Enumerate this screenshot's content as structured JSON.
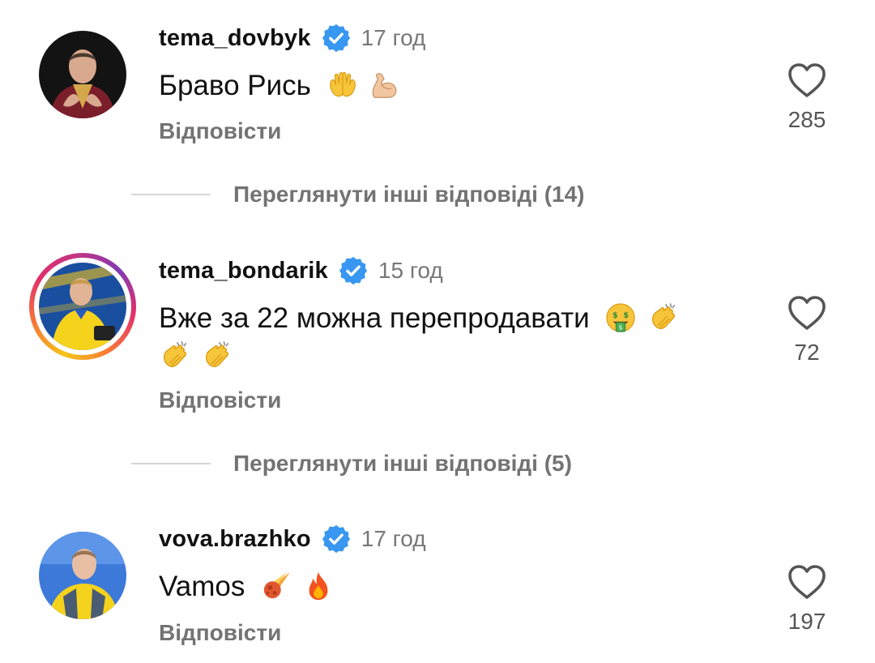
{
  "comments": [
    {
      "username": "tema_dovbyk",
      "time": "17 год",
      "text": "Браво Рись",
      "emojis": [
        "raising-hands-emoji",
        "flexed-biceps-emoji"
      ],
      "reply_label": "Відповісти",
      "likes": "285",
      "verified": true
    },
    {
      "username": "tema_bondarik",
      "time": "15 год",
      "text": "Вже за 22 можна перепродавати",
      "emojis": [
        "money-mouth-face-emoji",
        "clapping-hands-emoji",
        "clapping-hands-emoji",
        "clapping-hands-emoji"
      ],
      "reply_label": "Відповісти",
      "likes": "72",
      "verified": true,
      "has_story": true
    },
    {
      "username": "vova.brazhko",
      "time": "17 год",
      "text": "Vamos",
      "emojis": [
        "comet-emoji",
        "fire-emoji"
      ],
      "reply_label": "Відповісти",
      "likes": "197",
      "verified": true
    }
  ],
  "view_more": [
    {
      "label": "Переглянути інші відповіді (14)"
    },
    {
      "label": "Переглянути інші відповіді (5)"
    }
  ],
  "colors": {
    "verified_badge": "#3897f0",
    "secondary_text": "#737373",
    "primary_text": "#111111"
  }
}
